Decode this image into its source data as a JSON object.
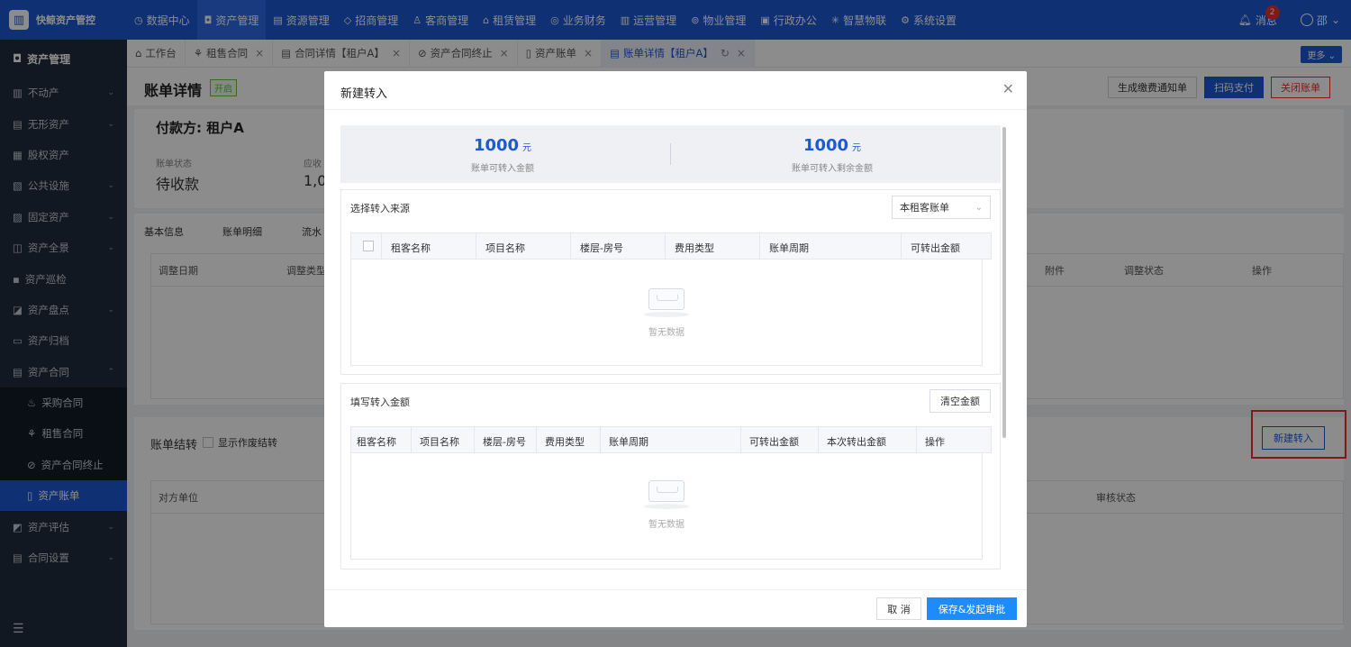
{
  "topbar": {
    "brand": "快鲸资产管控",
    "nav": [
      {
        "icon": "clock-icon",
        "glyph": "◷",
        "label": "数据中心"
      },
      {
        "icon": "cube-icon",
        "glyph": "◘",
        "label": "资产管理"
      },
      {
        "icon": "building-icon",
        "glyph": "▤",
        "label": "资源管理"
      },
      {
        "icon": "tag-icon",
        "glyph": "◇",
        "label": "招商管理"
      },
      {
        "icon": "users-icon",
        "glyph": "♙",
        "label": "客商管理"
      },
      {
        "icon": "home-icon",
        "glyph": "⌂",
        "label": "租赁管理"
      },
      {
        "icon": "coin-icon",
        "glyph": "◎",
        "label": "业务财务"
      },
      {
        "icon": "chart-icon",
        "glyph": "▥",
        "label": "运营管理"
      },
      {
        "icon": "property-icon",
        "glyph": "⊚",
        "label": "物业管理"
      },
      {
        "icon": "office-icon",
        "glyph": "▣",
        "label": "行政办公"
      },
      {
        "icon": "iot-icon",
        "glyph": "✳",
        "label": "智慧物联"
      },
      {
        "icon": "gear-icon",
        "glyph": "⚙",
        "label": "系统设置"
      }
    ],
    "message_label": "消息",
    "message_count": "2",
    "user_name": "邵"
  },
  "sidebar": {
    "header": "资产管理",
    "items": [
      {
        "label": "不动产",
        "glyph": "▥",
        "chevron": "⌄"
      },
      {
        "label": "无形资产",
        "glyph": "▤",
        "chevron": "⌄"
      },
      {
        "label": "股权资产",
        "glyph": "▦",
        "chevron": ""
      },
      {
        "label": "公共设施",
        "glyph": "▧",
        "chevron": "⌄"
      },
      {
        "label": "固定资产",
        "glyph": "▨",
        "chevron": "⌄"
      },
      {
        "label": "资产全景",
        "glyph": "◫",
        "chevron": "⌄"
      },
      {
        "label": "资产巡检",
        "glyph": "▪",
        "chevron": ""
      },
      {
        "label": "资产盘点",
        "glyph": "◪",
        "chevron": "⌄"
      },
      {
        "label": "资产归档",
        "glyph": "▭",
        "chevron": ""
      },
      {
        "label": "资产合同",
        "glyph": "▤",
        "chevron": "⌃"
      }
    ],
    "subitems": [
      {
        "label": "采购合同",
        "glyph": "♨"
      },
      {
        "label": "租售合同",
        "glyph": "⚘"
      },
      {
        "label": "资产合同终止",
        "glyph": "⊘"
      },
      {
        "label": "资产账单",
        "glyph": "▯"
      }
    ],
    "after": [
      {
        "label": "资产评估",
        "glyph": "◩",
        "chevron": "⌄"
      },
      {
        "label": "合同设置",
        "glyph": "▤",
        "chevron": "⌄"
      }
    ],
    "footer_glyph": "☰"
  },
  "tabs": [
    {
      "label": "工作台",
      "glyph": "⌂",
      "closable": false
    },
    {
      "label": "租售合同",
      "glyph": "⚘",
      "closable": true
    },
    {
      "label": "合同详情【租户A】",
      "glyph": "▤",
      "closable": true
    },
    {
      "label": "资产合同终止",
      "glyph": "⊘",
      "closable": true
    },
    {
      "label": "资产账单",
      "glyph": "▯",
      "closable": true
    },
    {
      "label": "账单详情【租户A】",
      "glyph": "▤",
      "closable": true,
      "active": true
    }
  ],
  "more_label": "更多",
  "page": {
    "title": "账单详情",
    "status": "开启",
    "buttons": {
      "notice": "生成缴费通知单",
      "scan": "扫码支付",
      "close": "关闭账单"
    },
    "payer": "付款方: 租户A",
    "bill_status_label": "账单状态",
    "bill_status_value": "待收款",
    "due_label": "应收",
    "due_value": "1,0",
    "info_tabs": [
      "基本信息",
      "账单明细",
      "流水"
    ],
    "adjust_cols": [
      "调整日期",
      "调整类型",
      "附件",
      "调整状态",
      "操作"
    ],
    "jie_title": "账单结转",
    "jie_check_label": "显示作废结转",
    "new_in_button": "新建转入",
    "jie_cols": [
      "对方单位",
      "审核状态"
    ]
  },
  "dialog": {
    "title": "新建转入",
    "summary": [
      {
        "value": "1000",
        "unit": "元",
        "label": "账单可转入金额"
      },
      {
        "value": "1000",
        "unit": "元",
        "label": "账单可转入剩余金额"
      }
    ],
    "source_title": "选择转入来源",
    "source_select": "本租客账单",
    "source_cols": [
      "租客名称",
      "项目名称",
      "楼层-房号",
      "费用类型",
      "账单周期",
      "可转出金额"
    ],
    "fill_title": "填写转入金额",
    "clear_button": "清空金额",
    "fill_cols": [
      "租客名称",
      "项目名称",
      "楼层-房号",
      "费用类型",
      "账单周期",
      "可转出金额",
      "本次转出金额",
      "操作"
    ],
    "empty_text": "暂无数据",
    "cancel_button": "取 消",
    "save_button": "保存&发起审批"
  }
}
